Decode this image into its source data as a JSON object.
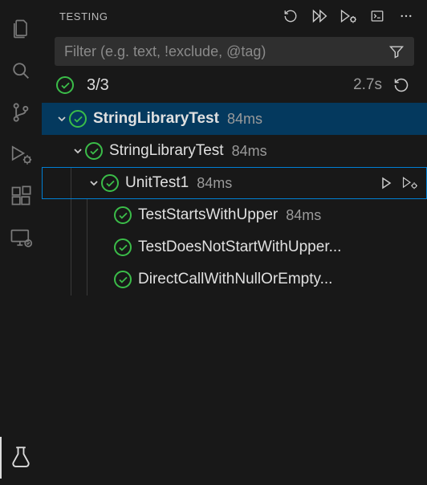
{
  "panel": {
    "title": "TESTING"
  },
  "filter": {
    "placeholder": "Filter (e.g. text, !exclude, @tag)"
  },
  "summary": {
    "count": "3/3",
    "duration": "2.7s"
  },
  "tree": {
    "root": {
      "label": "StringLibraryTest",
      "time": "84ms"
    },
    "level2": {
      "label": "StringLibraryTest",
      "time": "84ms"
    },
    "level3": {
      "label": "UnitTest1",
      "time": "84ms"
    },
    "tests": [
      {
        "label": "TestStartsWithUpper",
        "time": "84ms"
      },
      {
        "label": "TestDoesNotStartWithUpper...",
        "time": ""
      },
      {
        "label": "DirectCallWithNullOrEmpty...",
        "time": ""
      }
    ]
  }
}
